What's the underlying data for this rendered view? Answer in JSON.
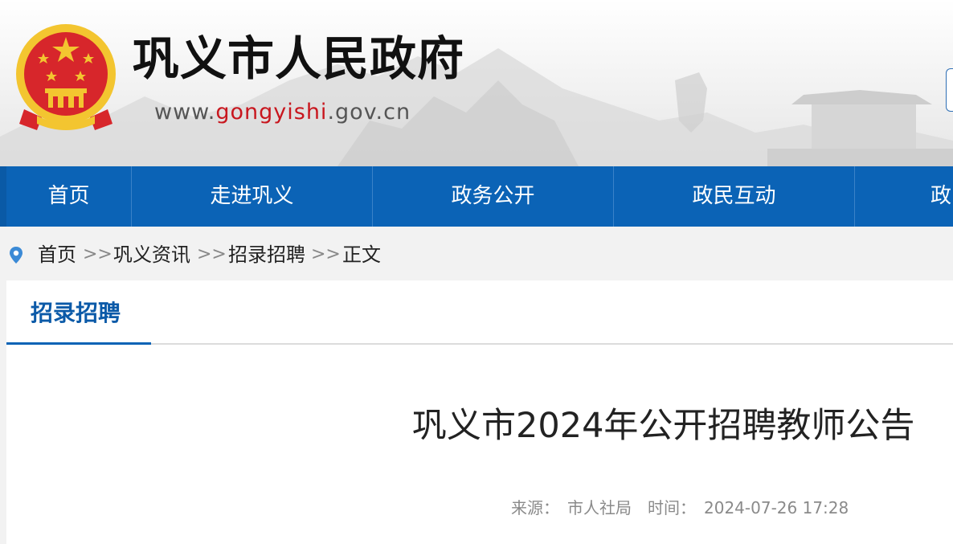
{
  "site": {
    "title": "巩义市人民政府",
    "url_prefix": "www.",
    "url_highlight": "gongyishi",
    "url_suffix": ".gov.cn"
  },
  "nav": {
    "items": [
      {
        "label": "首页"
      },
      {
        "label": "走进巩义"
      },
      {
        "label": "政务公开"
      },
      {
        "label": "政民互动"
      },
      {
        "label": "政"
      }
    ]
  },
  "breadcrumb": {
    "icon": "location-pin-icon",
    "items": [
      {
        "label": "首页"
      },
      {
        "label": "巩义资讯"
      },
      {
        "label": "招录招聘"
      },
      {
        "label": "正文"
      }
    ],
    "separator": ">>"
  },
  "section": {
    "label": "招录招聘"
  },
  "article": {
    "title": "巩义市2024年公开招聘教师公告",
    "source_label": "来源：",
    "source": "市人社局",
    "time_label": "时间：",
    "time": "2024-07-26 17:28"
  },
  "colors": {
    "nav_bg": "#0b63b6",
    "section_accent": "#0b5aa8",
    "emblem_red": "#d7262b",
    "emblem_gold": "#f3c530",
    "url_highlight": "#c8161e"
  }
}
